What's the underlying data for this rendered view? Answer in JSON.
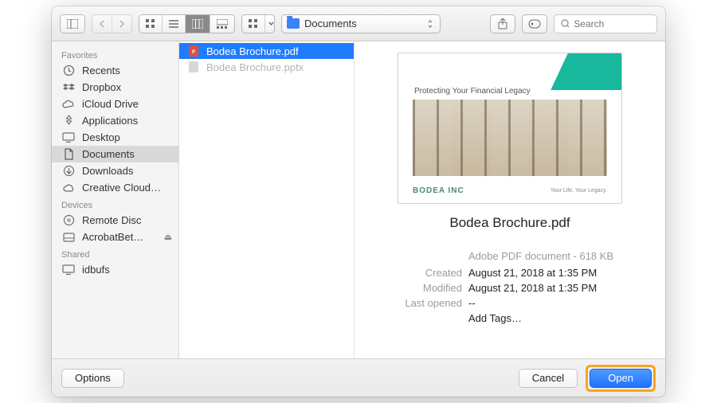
{
  "toolbar": {
    "location_label": "Documents",
    "search_placeholder": "Search"
  },
  "sidebar": {
    "sections": [
      {
        "header": "Favorites",
        "items": [
          {
            "label": "Recents",
            "icon": "clock"
          },
          {
            "label": "Dropbox",
            "icon": "dropbox"
          },
          {
            "label": "iCloud Drive",
            "icon": "cloud"
          },
          {
            "label": "Applications",
            "icon": "apps"
          },
          {
            "label": "Desktop",
            "icon": "desktop"
          },
          {
            "label": "Documents",
            "icon": "doc",
            "selected": true
          },
          {
            "label": "Downloads",
            "icon": "download"
          },
          {
            "label": "Creative Cloud…",
            "icon": "cc"
          }
        ]
      },
      {
        "header": "Devices",
        "items": [
          {
            "label": "Remote Disc",
            "icon": "disc"
          },
          {
            "label": "AcrobatBet…",
            "icon": "drive",
            "eject": true
          }
        ]
      },
      {
        "header": "Shared",
        "items": [
          {
            "label": "idbufs",
            "icon": "netdrive"
          }
        ]
      }
    ]
  },
  "files": [
    {
      "name": "Bodea Brochure.pdf",
      "kind": "pdf",
      "selected": true
    },
    {
      "name": "Bodea Brochure.pptx",
      "kind": "pptx",
      "dim": true
    }
  ],
  "preview": {
    "title": "Bodea Brochure.pdf",
    "kind_line": "Adobe PDF document - 618 KB",
    "thumb_caption": "Protecting Your Financial Legacy",
    "thumb_logo": "BODEA INC",
    "thumb_tagline": "Your Life. Your Legacy.",
    "rows": {
      "created": {
        "k": "Created",
        "v": "August 21, 2018 at 1:35 PM"
      },
      "modified": {
        "k": "Modified",
        "v": "August 21, 2018 at 1:35 PM"
      },
      "last_opened": {
        "k": "Last opened",
        "v": "--"
      }
    },
    "add_tags": "Add Tags…"
  },
  "footer": {
    "options": "Options",
    "cancel": "Cancel",
    "open": "Open"
  }
}
